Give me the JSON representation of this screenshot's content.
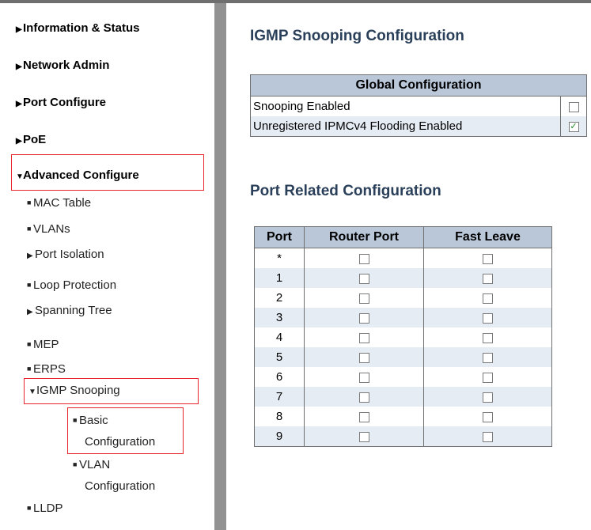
{
  "sidebar": {
    "top_menu": [
      {
        "label": "Information & Status",
        "icon": "triangle-right-icon"
      },
      {
        "label": "Network Admin",
        "icon": "triangle-right-icon"
      },
      {
        "label": "Port Configure",
        "icon": "triangle-right-icon"
      },
      {
        "label": "PoE",
        "icon": "triangle-right-icon"
      },
      {
        "label": "Advanced Configure",
        "icon": "triangle-down-icon",
        "expanded": true
      }
    ],
    "advanced_items": [
      {
        "label": "MAC Table"
      },
      {
        "label": "VLANs"
      },
      {
        "label": "Port Isolation"
      },
      {
        "label": "Loop Protection"
      },
      {
        "label": "Spanning Tree"
      },
      {
        "label": "MEP"
      },
      {
        "label": "ERPS"
      },
      {
        "label": "IGMP Snooping",
        "expanded": true
      },
      {
        "label": "LLDP"
      }
    ],
    "igmp_items": [
      {
        "line1": "Basic",
        "line2": "Configuration"
      },
      {
        "line1": "VLAN",
        "line2": "Configuration"
      }
    ]
  },
  "main": {
    "title": "IGMP Snooping Configuration",
    "global": {
      "header": "Global Configuration",
      "rows": [
        {
          "label": "Snooping Enabled",
          "checked": false
        },
        {
          "label": "Unregistered IPMCv4 Flooding Enabled",
          "checked": true
        }
      ]
    },
    "port_section_title": "Port Related Configuration",
    "port_table": {
      "headers": [
        "Port",
        "Router Port",
        "Fast Leave"
      ],
      "rows": [
        {
          "port": "*",
          "router": false,
          "fast": false
        },
        {
          "port": "1",
          "router": false,
          "fast": false
        },
        {
          "port": "2",
          "router": false,
          "fast": false
        },
        {
          "port": "3",
          "router": false,
          "fast": false
        },
        {
          "port": "4",
          "router": false,
          "fast": false
        },
        {
          "port": "5",
          "router": false,
          "fast": false
        },
        {
          "port": "6",
          "router": false,
          "fast": false
        },
        {
          "port": "7",
          "router": false,
          "fast": false
        },
        {
          "port": "8",
          "router": false,
          "fast": false
        },
        {
          "port": "9",
          "router": false,
          "fast": false
        }
      ]
    }
  },
  "colors": {
    "highlight_border": "#e8242b",
    "table_header": "#b9c7d9",
    "row_alt": "#e5ecf4",
    "title": "#2a3f59"
  }
}
